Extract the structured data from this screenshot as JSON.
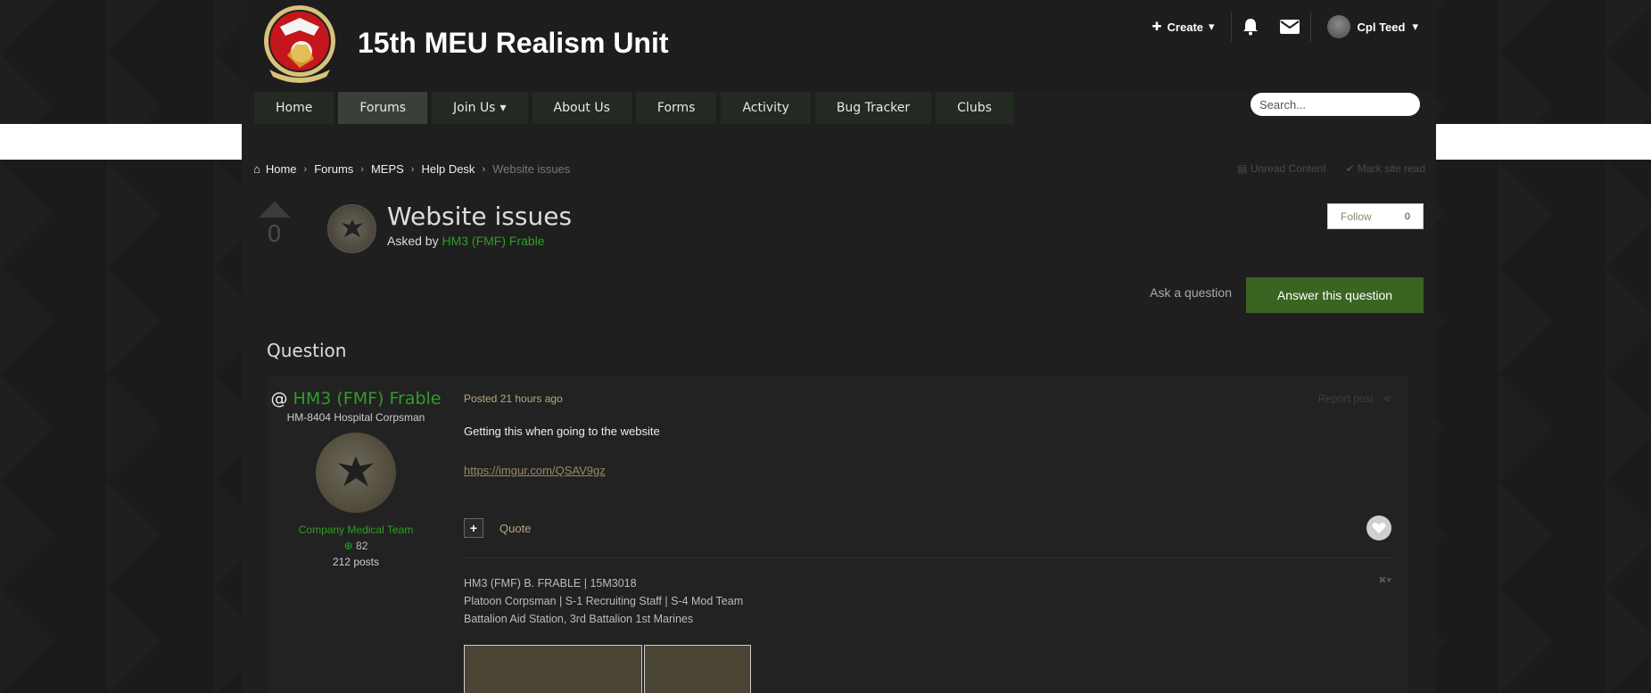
{
  "site": {
    "title": "15th MEU Realism Unit"
  },
  "userbar": {
    "create_label": "Create",
    "username": "Cpl Teed"
  },
  "nav": {
    "items": [
      {
        "label": "Home"
      },
      {
        "label": "Forums"
      },
      {
        "label": "Join Us"
      },
      {
        "label": "About Us"
      },
      {
        "label": "Forms"
      },
      {
        "label": "Activity"
      },
      {
        "label": "Bug Tracker"
      },
      {
        "label": "Clubs"
      }
    ],
    "active": "Forums"
  },
  "search": {
    "placeholder": "Search..."
  },
  "breadcrumb": {
    "items": [
      "Home",
      "Forums",
      "MEPS",
      "Help Desk"
    ],
    "current": "Website issues",
    "unread": "Unread Content",
    "mark_read": "Mark site read"
  },
  "topic": {
    "vote_count": "0",
    "title": "Website issues",
    "asked_by_prefix": "Asked by",
    "author": "HM3 (FMF) Frable",
    "follow_label": "Follow",
    "follow_count": "0",
    "ask_label": "Ask a question",
    "answer_label": "Answer this question",
    "section_label": "Question"
  },
  "post": {
    "author_at": "@",
    "author_name": "HM3 (FMF) Frable",
    "author_rank": "HM-8404 Hospital Corpsman",
    "author_group": "Company Medical Team",
    "reputation": "82",
    "post_count": "212 posts",
    "posted": "Posted 21 hours ago",
    "report_label": "Report post",
    "text": "Getting this when going to the website",
    "link": "https://imgur.com/QSAV9gz",
    "quote_label": "Quote",
    "signature": [
      "HM3 (FMF) B. FRABLE | 15M3018",
      "Platoon Corpsman | S-1 Recruiting Staff | S-4 Mod Team",
      "Battalion Aid Station, 3rd Battalion 1st Marines"
    ]
  },
  "colors": {
    "accent_green": "#2e9e28",
    "button_green": "#3a6422"
  }
}
